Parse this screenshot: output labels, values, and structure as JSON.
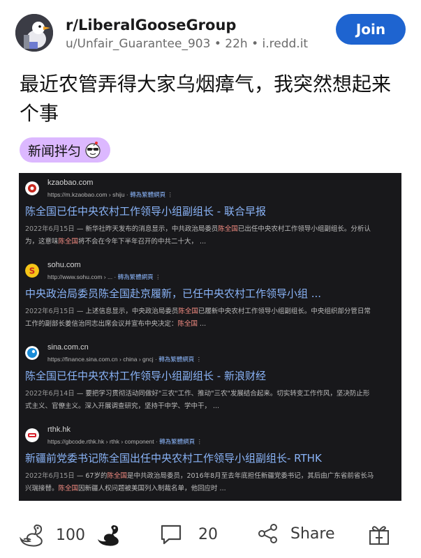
{
  "header": {
    "subreddit": "r/LiberalGooseGroup",
    "username": "u/Unfair_Guarantee_903",
    "age": "22h",
    "domain": "i.redd.it",
    "join_label": "Join"
  },
  "post": {
    "title": "最近农管弄得大家乌烟瘴气，我突然想起来个事",
    "flair": "新闻拌匀"
  },
  "screenshot": {
    "results": [
      {
        "site": "kzaobao.com",
        "url": "https://m.kzaobao.com › shiju",
        "translate": "轉為繁體網頁",
        "title": "陈全国已任中央农村工作领导小组副组长 - 联合早报",
        "date": "2022年6月15日",
        "snippet_a": " — 新华社昨天发布的消息显示，中共政治局委员",
        "snippet_hl": "陈全国",
        "snippet_b": "已出任中央农村工作领导小组副组长。分析认为，这意味",
        "snippet_hl2": "陈全国",
        "snippet_c": "将不会在今年下半年召开的中共二十大， ..."
      },
      {
        "site": "sohu.com",
        "url": "http://www.sohu.com › ...",
        "translate": "轉為繁體網頁",
        "title": "中央政治局委员陈全国赴京履新，已任中央农村工作领导小组 ...",
        "date": "2022年6月15日",
        "snippet_a": " — 上述信息显示，中央政治局委员",
        "snippet_hl": "陈全国",
        "snippet_b": "已履新中央农村工作领导小组副组长。中央组织部分管日常工作的副部长姜信治同志出席会议并宣布中央决定：",
        "snippet_hl2": "陈全国",
        "snippet_c": " ..."
      },
      {
        "site": "sina.com.cn",
        "url": "https://finance.sina.com.cn › china › gncj",
        "translate": "轉為繁體網頁",
        "title": "陈全国已任中央农村工作领导小组副组长 - 新浪财经",
        "date": "2022年6月14日",
        "snippet_a": " — 要把学习贯彻活动同做好\"三农\"工作、推动\"三农\"发展结合起来。切实转变工作作风，坚决防止形式主义、官僚主义。深入开展调查研究，坚持干中学、学中干， ...",
        "snippet_hl": "",
        "snippet_b": "",
        "snippet_hl2": "",
        "snippet_c": ""
      },
      {
        "site": "rthk.hk",
        "url": "https://gbcode.rthk.hk › rthk › component",
        "translate": "轉為繁體網頁",
        "title": "新疆前党委书记陈全国出任中央农村工作领导小组副组长- RTHK",
        "date": "2022年6月15日",
        "snippet_a": " — 67岁的",
        "snippet_hl": "陈全国",
        "snippet_b": "是中共政治局委员，2016年8月至去年底担任新疆党委书记，其后由广东省前省长马兴瑞接替。",
        "snippet_hl2": "陈全国",
        "snippet_c": "因新疆人权问题被美国列入制裁名单，他回应时 ..."
      }
    ]
  },
  "actions": {
    "upvotes": "100",
    "comments": "20",
    "share_label": "Share"
  },
  "colors": {
    "join": "#1e64d0",
    "flair": "#dcb8ff",
    "link": "#8ab4f8",
    "highlight": "#f28b82"
  }
}
